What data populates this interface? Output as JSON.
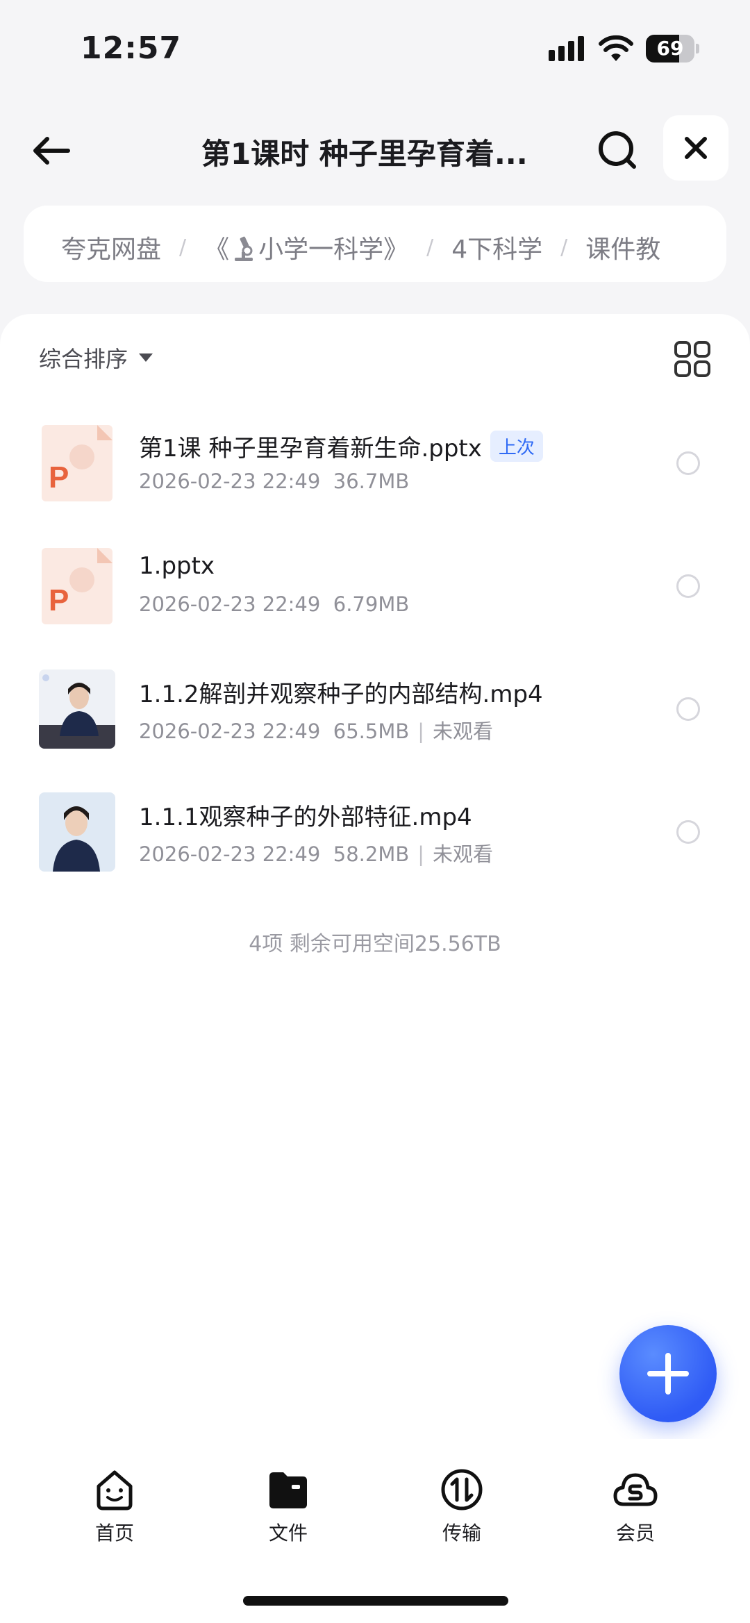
{
  "status": {
    "time": "12:57",
    "battery": "69",
    "battery_level": 0.69
  },
  "header": {
    "title": "第1课时 种子里孕育着..."
  },
  "breadcrumb": {
    "items": [
      "夸克网盘",
      "《",
      "小学一科学》",
      "4下科学",
      "课件教"
    ],
    "separator": "/"
  },
  "toolbar": {
    "sort_label": "综合排序"
  },
  "files": [
    {
      "name": "第1课 种子里孕育着新生命.pptx",
      "badge": "上次",
      "date": "2026-02-23 22:49",
      "size": "36.7MB",
      "extra": "",
      "type": "pptx"
    },
    {
      "name": "1.pptx",
      "badge": "",
      "date": "2026-02-23 22:49",
      "size": "6.79MB",
      "extra": "",
      "type": "pptx"
    },
    {
      "name": "1.1.2解剖并观察种子的内部结构.mp4",
      "badge": "",
      "date": "2026-02-23 22:49",
      "size": "65.5MB",
      "extra": "未观看",
      "type": "mp4"
    },
    {
      "name": "1.1.1观察种子的外部特征.mp4",
      "badge": "",
      "date": "2026-02-23 22:49",
      "size": "58.2MB",
      "extra": "未观看",
      "type": "mp4"
    }
  ],
  "summary": "4项 剩余可用空间25.56TB",
  "tabs": [
    {
      "label": "首页",
      "icon": "home-face-icon"
    },
    {
      "label": "文件",
      "icon": "folder-icon"
    },
    {
      "label": "传输",
      "icon": "transfer-icon"
    },
    {
      "label": "会员",
      "icon": "vip-cloud-icon"
    }
  ],
  "colors": {
    "accent": "#2f5bf5",
    "ppt": "#e8633d",
    "badge_bg": "#e6eeff"
  }
}
